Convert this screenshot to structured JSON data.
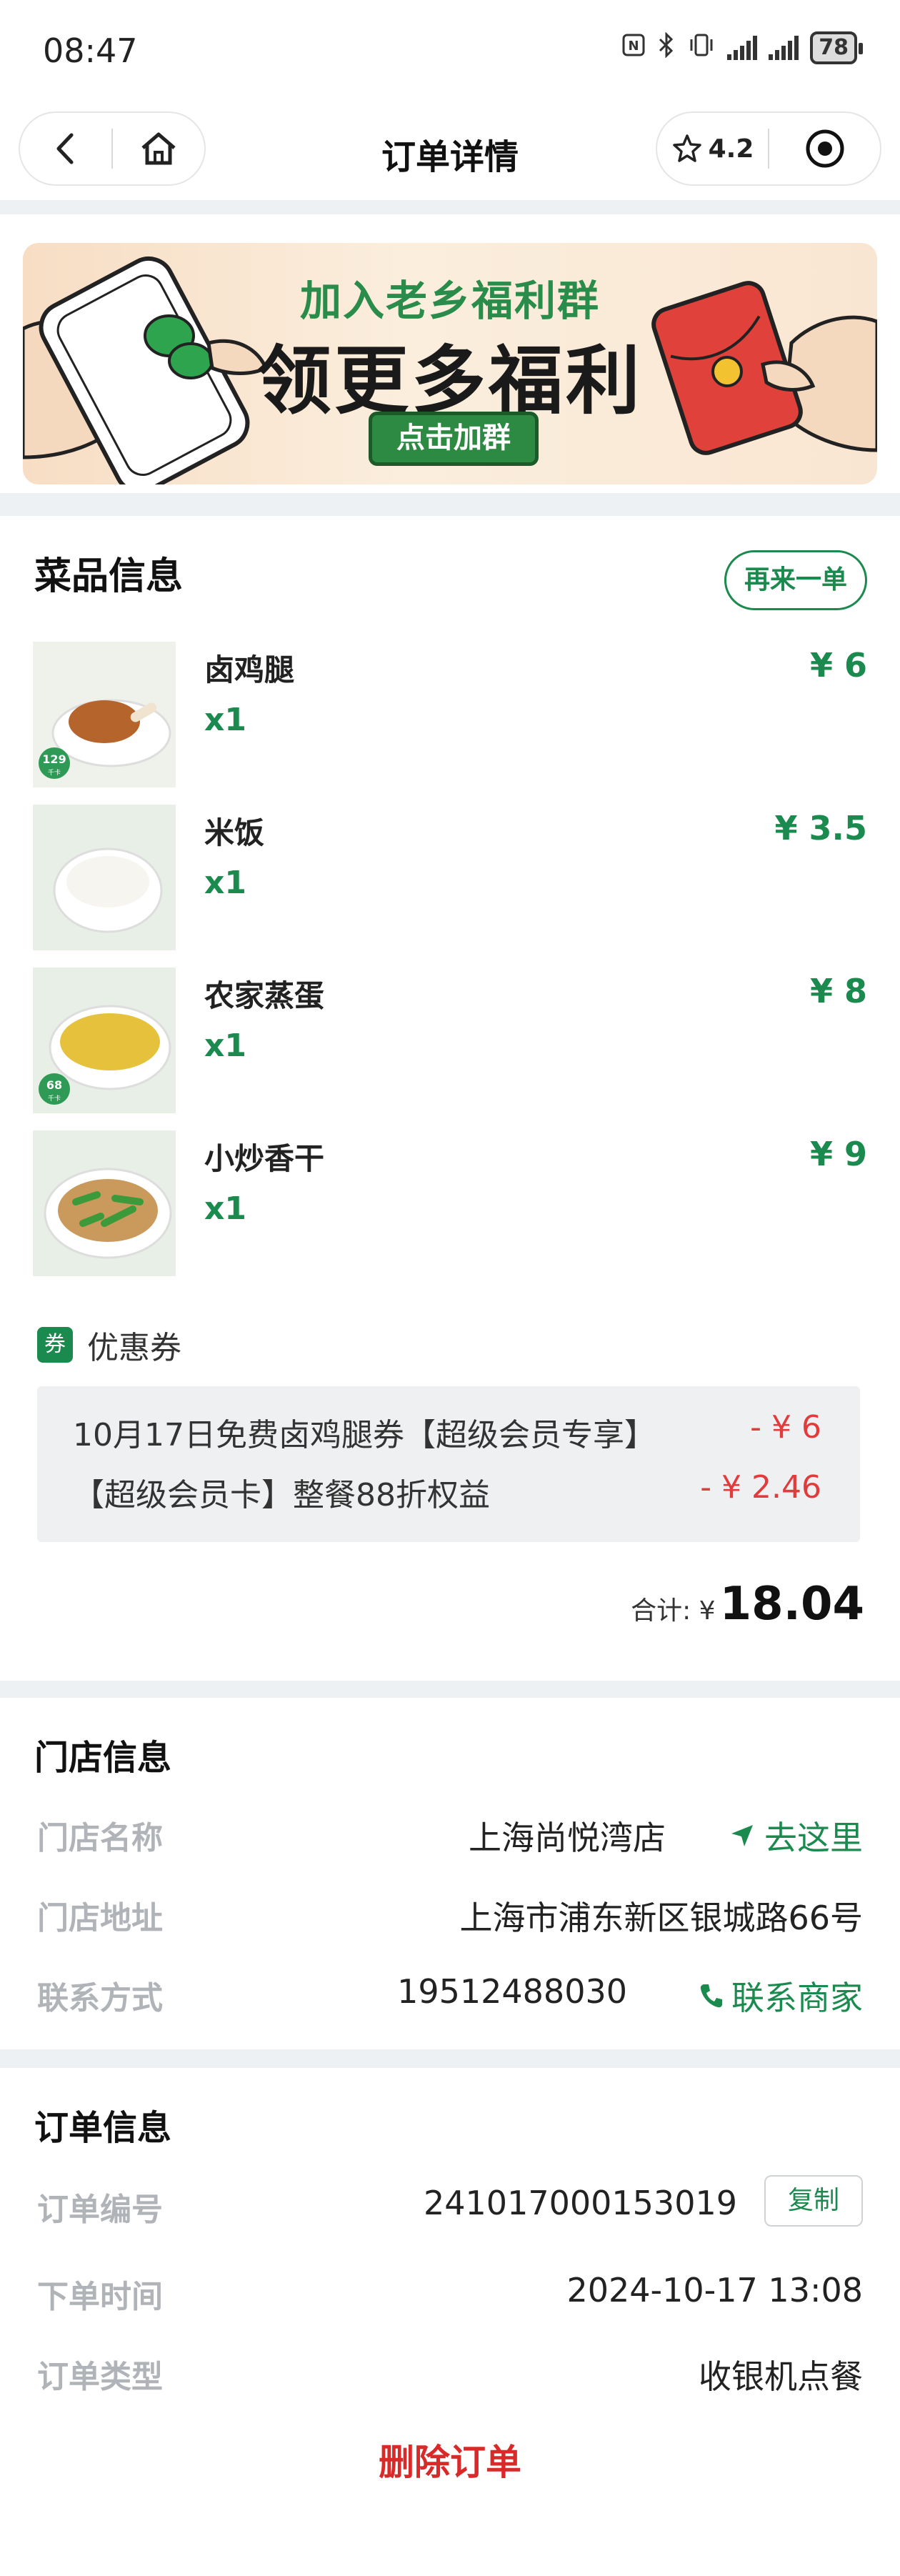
{
  "status_bar": {
    "time": "08:47",
    "battery": "78",
    "icons": [
      "nfc-icon",
      "bluetooth-icon",
      "vibrate-icon",
      "signal-icon",
      "signal-icon",
      "battery-icon"
    ]
  },
  "nav": {
    "title": "订单详情",
    "rating": "4.2"
  },
  "banner": {
    "line1": "加入老乡福利群",
    "line2": "领更多福利",
    "cta": "点击加群"
  },
  "dishes": {
    "title": "菜品信息",
    "again_label": "再来一单",
    "items": [
      {
        "name": "卤鸡腿",
        "qty": "x1",
        "price": "¥ 6",
        "kcal": "129"
      },
      {
        "name": "米饭",
        "qty": "x1",
        "price": "¥ 3.5",
        "kcal": ""
      },
      {
        "name": "农家蒸蛋",
        "qty": "x1",
        "price": "¥ 8",
        "kcal": "68"
      },
      {
        "name": "小炒香干",
        "qty": "x1",
        "price": "¥ 9",
        "kcal": ""
      }
    ],
    "kcal_unit": "千卡",
    "coupon_badge": "券",
    "coupon_label": "优惠券",
    "coupons": [
      {
        "name": "10月17日免费卤鸡腿券【超级会员专享】",
        "amount": "- ¥ 6"
      },
      {
        "name": "【超级会员卡】整餐88折权益",
        "amount": "- ¥ 2.46"
      }
    ],
    "total_label": "合计: ¥",
    "total_value": "18.04"
  },
  "store": {
    "title": "门店信息",
    "name_label": "门店名称",
    "name_value": "上海尚悦湾店",
    "go_label": "去这里",
    "address_label": "门店地址",
    "address_value": "上海市浦东新区银城路66号",
    "contact_label": "联系方式",
    "contact_value": "19512488030",
    "call_label": "联系商家"
  },
  "order": {
    "title": "订单信息",
    "number_label": "订单编号",
    "number_value": "241017000153019",
    "copy_label": "复制",
    "time_label": "下单时间",
    "time_value": "2024-10-17 13:08",
    "type_label": "订单类型",
    "type_value": "收银机点餐",
    "delete_label": "删除订单"
  },
  "colors": {
    "accent_green": "#1b8a4e",
    "discount_red": "#e23b3b",
    "delete_red": "#d92a2a",
    "background": "#eef1f3"
  }
}
